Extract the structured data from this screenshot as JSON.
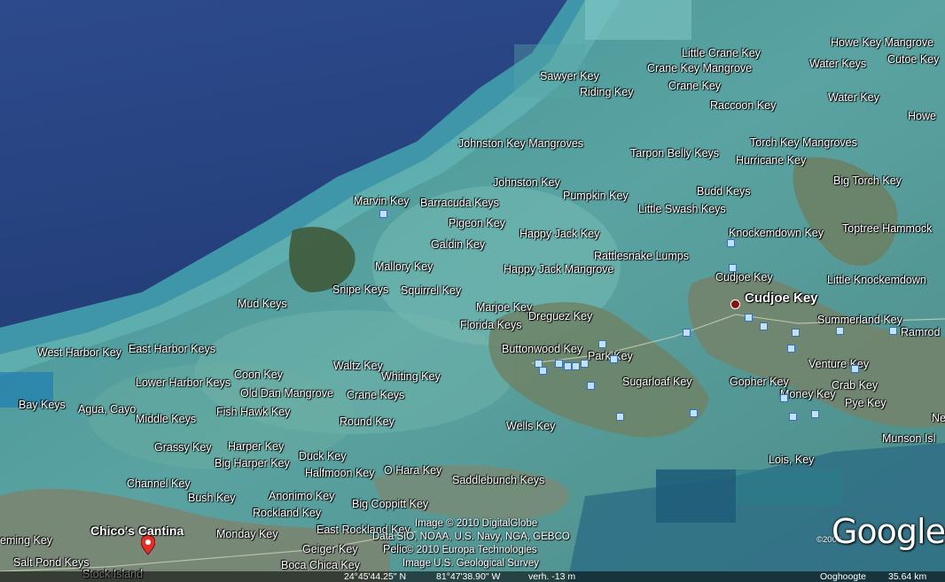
{
  "labels": [
    {
      "t": "Little Crane Key"
    },
    {
      "t": "Howe Key Mangrove"
    },
    {
      "t": "Cutoe Key"
    },
    {
      "t": "Sawyer Key"
    },
    {
      "t": "Crane Key Mangrove"
    },
    {
      "t": "Water Keys"
    },
    {
      "t": "Riding Key"
    },
    {
      "t": "Crane Key"
    },
    {
      "t": "Water Key"
    },
    {
      "t": "Raccoon Key"
    },
    {
      "t": "Howe"
    },
    {
      "t": "Johnston Key Mangroves"
    },
    {
      "t": "Torch Key Mangroves"
    },
    {
      "t": "Tarpon Belly Keys"
    },
    {
      "t": "Hurricane Key"
    },
    {
      "t": "Johnston Key"
    },
    {
      "t": "Big Torch Key"
    },
    {
      "t": "Budd Keys"
    },
    {
      "t": "Pumpkin Key"
    },
    {
      "t": "Marvin Key"
    },
    {
      "t": "Barracuda Keys"
    },
    {
      "t": "Little Swash Keys"
    },
    {
      "t": "Pigeon Key"
    },
    {
      "t": "Happy Jack Key"
    },
    {
      "t": "Knockemdown Key"
    },
    {
      "t": "Toptree Hammock"
    },
    {
      "t": "Galdin Key"
    },
    {
      "t": "Rattlesnake Lumps"
    },
    {
      "t": "Mallory Key"
    },
    {
      "t": "Happy Jack Mangrove"
    },
    {
      "t": "Cudjoe Key"
    },
    {
      "t": "Little Knockemdown"
    },
    {
      "t": "Snipe Keys"
    },
    {
      "t": "Squirrel Key"
    },
    {
      "t": "Mud Keys"
    },
    {
      "t": "Marjoe Key"
    },
    {
      "t": "Dreguez Key"
    },
    {
      "t": "Summerland Key"
    },
    {
      "t": "Florida Keys"
    },
    {
      "t": "Ramrod"
    },
    {
      "t": "East Harbor Keys"
    },
    {
      "t": "West Harbor Key"
    },
    {
      "t": "Buttonwood Key"
    },
    {
      "t": "Park Key"
    },
    {
      "t": "Venture Key"
    },
    {
      "t": "Waltz Key"
    },
    {
      "t": "Coon Key"
    },
    {
      "t": "Whiting Key"
    },
    {
      "t": "Lower Harbor Keys"
    },
    {
      "t": "Sugarloaf Key"
    },
    {
      "t": "Gopher Key"
    },
    {
      "t": "Crab Key"
    },
    {
      "t": "Old Dan Mangrove"
    },
    {
      "t": "Crane Keys"
    },
    {
      "t": "Money Key"
    },
    {
      "t": "Pye Key"
    },
    {
      "t": "Bay Keys"
    },
    {
      "t": "Agua, Cayo"
    },
    {
      "t": "Fish Hawk Key"
    },
    {
      "t": "Middle Keys"
    },
    {
      "t": "Round Key"
    },
    {
      "t": "Ne"
    },
    {
      "t": "Wells Key"
    },
    {
      "t": "Munson Isl"
    },
    {
      "t": "Grassy Key"
    },
    {
      "t": "Harper Key"
    },
    {
      "t": "Duck Key"
    },
    {
      "t": "Big Harper Key"
    },
    {
      "t": "Lois, Key"
    },
    {
      "t": "Halfmoon Key"
    },
    {
      "t": "O Hara Key"
    },
    {
      "t": "Channel Key"
    },
    {
      "t": "Saddlebunch Keys"
    },
    {
      "t": "Bush Key"
    },
    {
      "t": "Anonimo Key"
    },
    {
      "t": "Big Coppitt Key"
    },
    {
      "t": "Rockland Key"
    },
    {
      "t": "Monday Key"
    },
    {
      "t": "East Rockland Key"
    },
    {
      "t": "eming Key"
    },
    {
      "t": "Geiger Key"
    },
    {
      "t": "Pelic"
    },
    {
      "t": "Salt Pond Keys"
    },
    {
      "t": "Boca Chica Key"
    },
    {
      "t": "Stock Island"
    }
  ],
  "town": {
    "label": "Cudjoe Key"
  },
  "place": {
    "label": "Chico's Cantina"
  },
  "credits": [
    "Image © 2010 DigitalGlobe",
    "Data SIO, NOAA, U.S. Navy, NGA, GEBCO",
    "© 2010 Europa Technologies",
    "Image U.S. Geological Survey"
  ],
  "logo": {
    "text": "Google",
    "year": "©2009"
  },
  "status": {
    "lat": "24°45'44.25\" N",
    "lon": "81°47'38.90\" W",
    "elev": "verh.  -13 m",
    "eye_label": "Ooghoogte",
    "eye_value": "35.64 km"
  },
  "colors": {
    "deep_water": "#2e4a8a",
    "shallow": "#4f9a9e",
    "land": "#5c7a55"
  }
}
